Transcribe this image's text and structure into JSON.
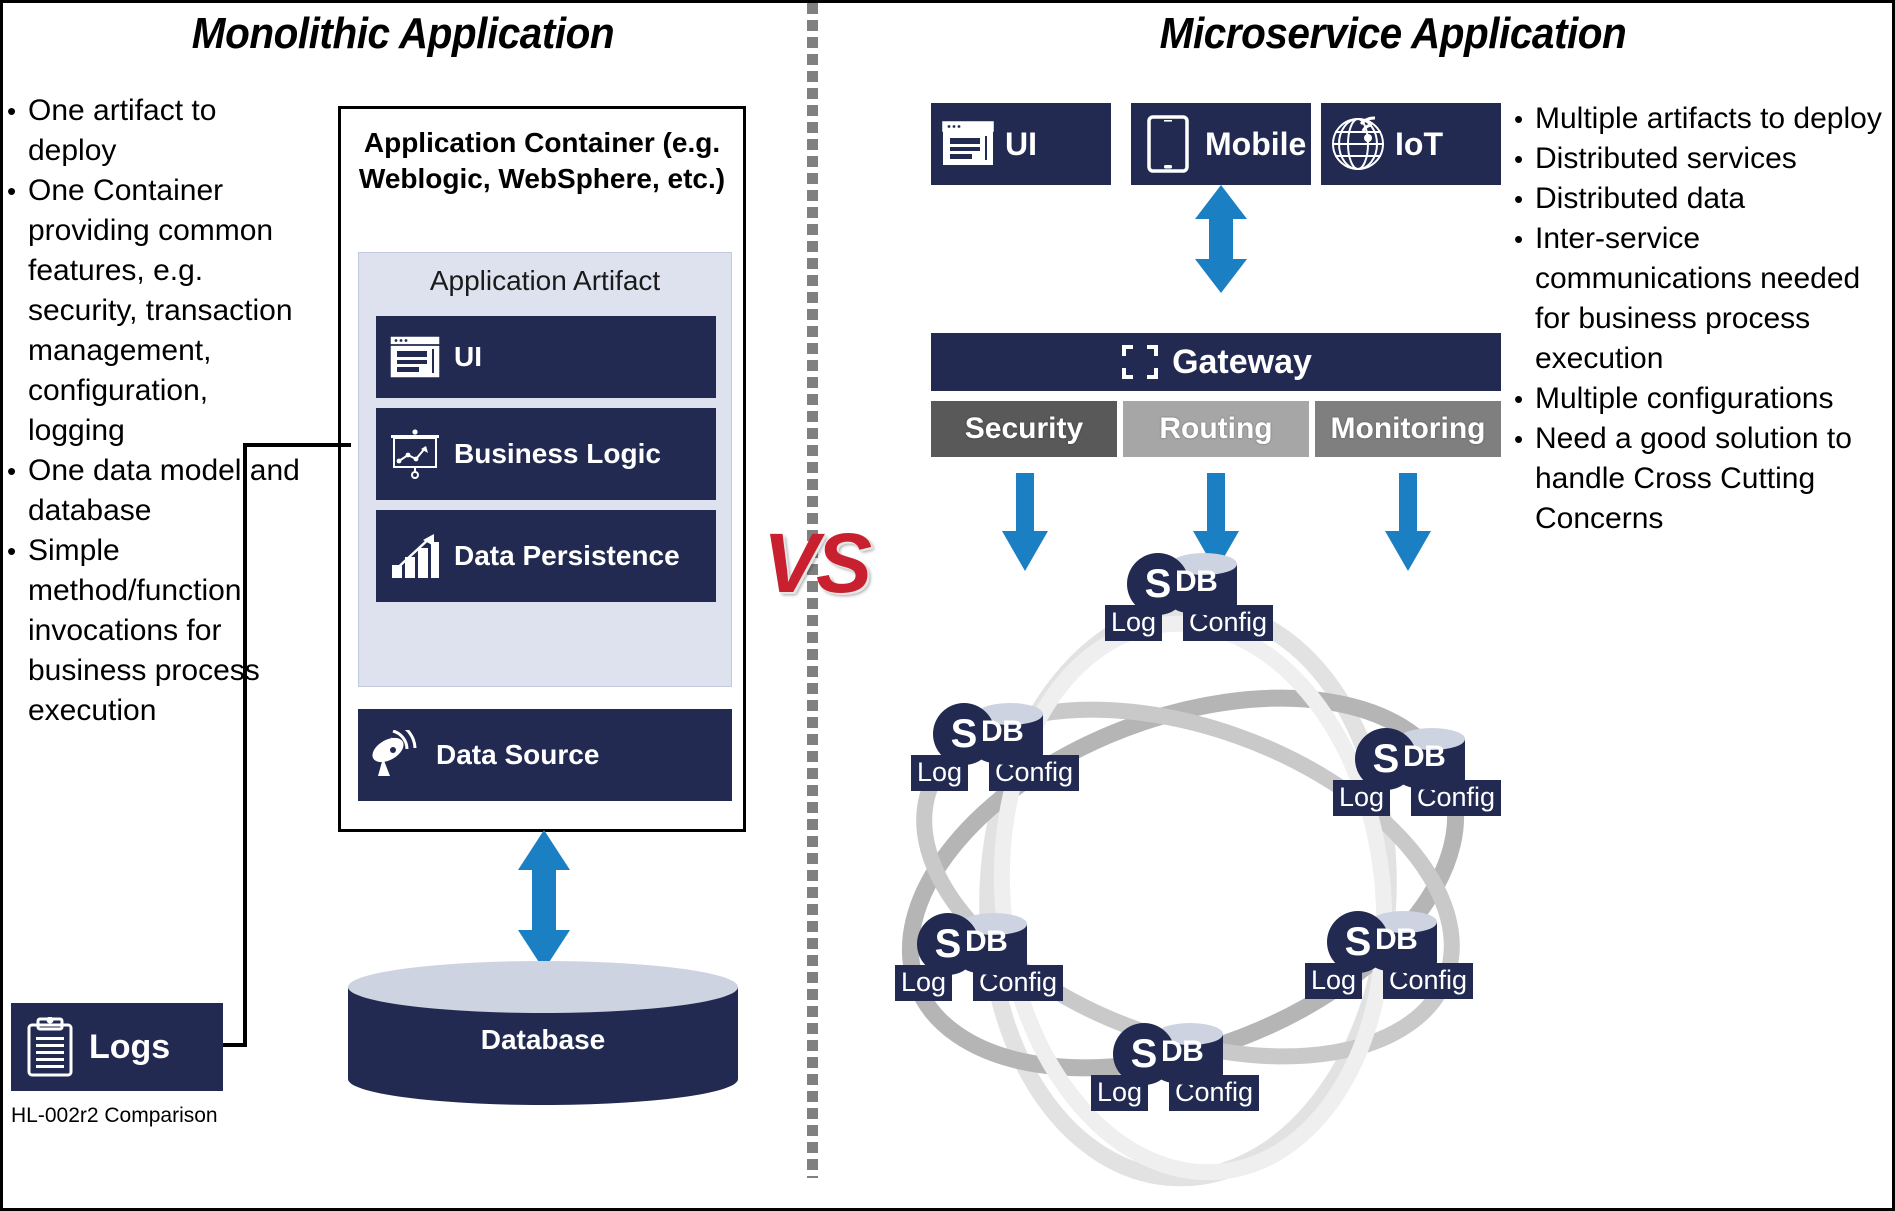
{
  "panels": {
    "left_title": "Monolithic Application",
    "right_title": "Microservice Application"
  },
  "colors": {
    "navy": "#222A52",
    "artifact_bg": "#DDE2EE",
    "blue_arrow": "#1B7FC4",
    "security_gray": "#595959",
    "routing_gray": "#A6A6A6",
    "monitoring_gray": "#7F7F7F",
    "divider_gray": "#808080",
    "vs_red": "#C8202E"
  },
  "left": {
    "bullets": [
      "One artifact to deploy",
      "One Container providing common features, e.g. security, transaction management, configuration, logging",
      "One data model and database",
      "Simple method/function invocations for business process execution"
    ],
    "container_title": "Application Container (e.g. Weblogic, WebSphere, etc.)",
    "artifact_title": "Application Artifact",
    "blocks": [
      {
        "label": "UI",
        "icon": "browser-window-icon"
      },
      {
        "label": "Business Logic",
        "icon": "presentation-chart-icon"
      },
      {
        "label": "Data Persistence",
        "icon": "bar-chart-growth-icon"
      },
      {
        "label": "Data Source",
        "icon": "satellite-dish-icon"
      }
    ],
    "database_label": "Database",
    "logs_label": "Logs",
    "caption": "HL-002r2 Comparison"
  },
  "center": {
    "vs_label": "VS"
  },
  "right": {
    "bullets": [
      "Multiple artifacts to deploy",
      "Distributed services",
      "Distributed data",
      "Inter-service communications needed for business process execution",
      "Multiple configurations",
      "Need a good solution to handle Cross Cutting Concerns"
    ],
    "channels": [
      {
        "label": "UI",
        "icon": "browser-window-icon"
      },
      {
        "label": "Mobile",
        "icon": "tablet-device-icon"
      },
      {
        "label": "IoT",
        "icon": "globe-wifi-icon"
      }
    ],
    "gateway_label": "Gateway",
    "gateway_icon": "crop-frame-icon",
    "gateway_features": [
      "Security",
      "Routing",
      "Monitoring"
    ],
    "service_node": {
      "service_letter": "S",
      "db_label": "DB",
      "log_label": "Log",
      "config_label": "Config"
    },
    "service_count": 6
  }
}
